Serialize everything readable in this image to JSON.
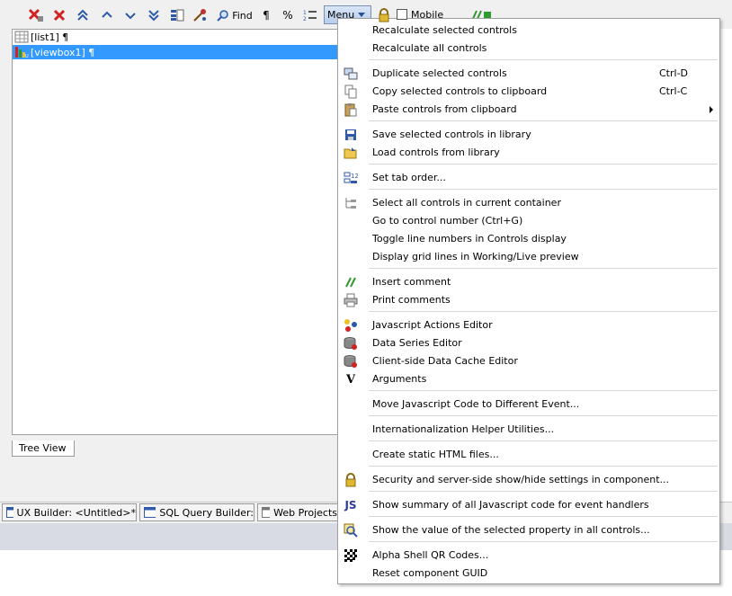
{
  "toolbar": {
    "find_label": "Find",
    "pilcrow_label": "¶",
    "percent_label": "%",
    "menu_label": "Menu",
    "mobile_label": "Mobile"
  },
  "tree": {
    "rows": [
      {
        "label": "[list1] ¶"
      },
      {
        "label": "[viewbox1] ¶"
      }
    ],
    "tab_label": "Tree View"
  },
  "bottom_tabs": [
    {
      "label": "UX Builder: <Untitled>*"
    },
    {
      "label": "SQL Query Builder:"
    },
    {
      "label": "Web Projects"
    }
  ],
  "menu": {
    "items": [
      {
        "label": "Recalculate selected controls",
        "icon": "none"
      },
      {
        "label": "Recalculate all controls",
        "icon": "none"
      },
      {
        "label": "Duplicate selected controls",
        "shortcut": "Ctrl-D",
        "icon": "duplicate-icon"
      },
      {
        "label": "Copy selected controls to clipboard",
        "shortcut": "Ctrl-C",
        "icon": "copy-icon"
      },
      {
        "label": "Paste controls from clipboard",
        "icon": "paste-icon"
      },
      {
        "label": "Save selected controls in library",
        "icon": "save-icon"
      },
      {
        "label": "Load controls from library",
        "icon": "folder-icon"
      },
      {
        "label": "Set tab order...",
        "icon": "tab-order-icon"
      },
      {
        "label": "Select all controls in current container",
        "icon": "tree-icon"
      },
      {
        "label": "Go to control number (Ctrl+G)",
        "icon": "none"
      },
      {
        "label": "Toggle line numbers in Controls display",
        "icon": "none"
      },
      {
        "label": "Display grid lines in Working/Live preview",
        "icon": "none"
      },
      {
        "label": "Insert comment",
        "icon": "comment-icon"
      },
      {
        "label": "Print comments",
        "icon": "printer-icon"
      },
      {
        "label": "Javascript Actions Editor",
        "icon": "actions-icon"
      },
      {
        "label": "Data Series Editor",
        "icon": "database-icon"
      },
      {
        "label": "Client-side Data Cache Editor",
        "icon": "database-icon"
      },
      {
        "label": "Arguments",
        "icon": "arguments-icon"
      },
      {
        "label": "Move Javascript Code to Different Event...",
        "icon": "none"
      },
      {
        "label": "Internationalization Helper Utilities...",
        "icon": "none"
      },
      {
        "label": "Create static HTML files...",
        "icon": "none"
      },
      {
        "label": "Security and server-side show/hide settings in component...",
        "icon": "lock-icon"
      },
      {
        "label": "Show summary of all Javascript code for event handlers",
        "icon": "js-icon"
      },
      {
        "label": "Show the value of the selected property in all controls...",
        "icon": "magnifier-icon"
      },
      {
        "label": "Alpha Shell QR Codes...",
        "icon": "qr-icon"
      },
      {
        "label": "Reset component GUID",
        "icon": "none"
      }
    ],
    "js_icon_text": "JS",
    "arguments_icon_text": "V"
  },
  "colors": {
    "selection": "#3399ff",
    "menu_button": "#c5d8f1",
    "status_bar": "#d9dbe4"
  }
}
